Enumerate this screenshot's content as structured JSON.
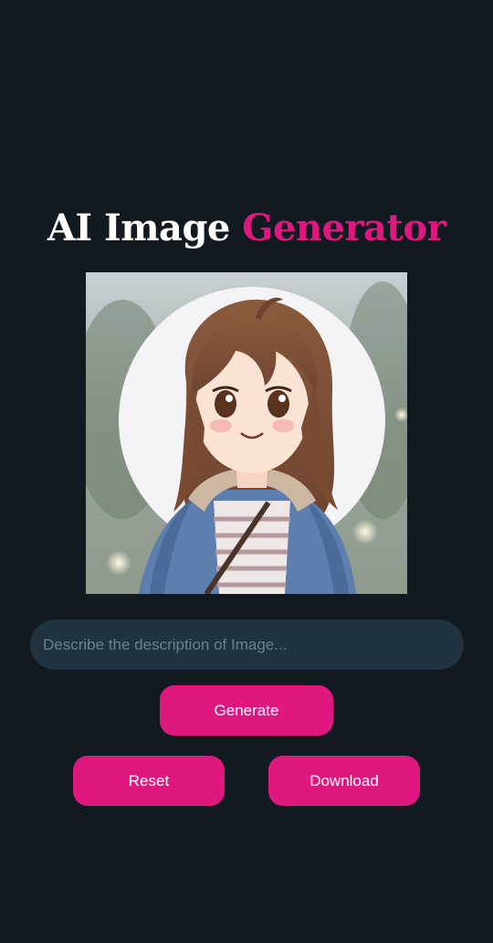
{
  "header": {
    "title_part1": "AI Image",
    "title_part2": "Generator"
  },
  "image": {
    "subject": "anime-girl-portrait"
  },
  "prompt": {
    "placeholder": "Describe the description of Image...",
    "value": ""
  },
  "buttons": {
    "generate_label": "Generate",
    "reset_label": "Reset",
    "download_label": "Download"
  },
  "colors": {
    "background": "#111a21",
    "accent": "#e0177f",
    "input_bg": "#21333f",
    "title_text": "#ffffff"
  }
}
